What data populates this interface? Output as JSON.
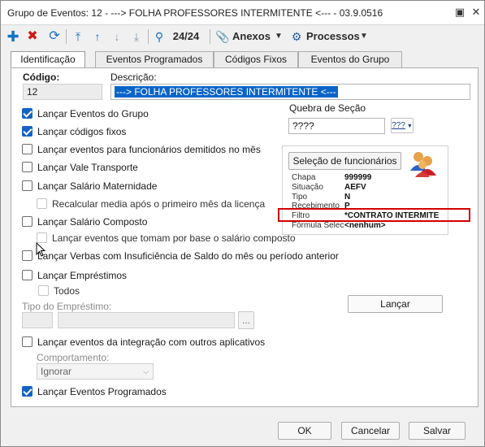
{
  "window": {
    "title": "Grupo de Eventos: 12 - ---> FOLHA PROFESSORES INTERMITENTE <--- - 03.9.0516"
  },
  "toolbar": {
    "record_position": "24/24",
    "anexos_label": "Anexos",
    "processos_label": "Processos"
  },
  "tabs": [
    "Identificação",
    "Eventos Programados",
    "Códigos Fixos",
    "Eventos do Grupo"
  ],
  "form": {
    "codigo_label": "Código:",
    "codigo_value": "12",
    "descricao_label": "Descrição:",
    "descricao_value": "---> FOLHA PROFESSORES INTERMITENTE <---",
    "quebra_label": "Quebra de Seção",
    "quebra_value": "????",
    "quebra_button": "???"
  },
  "options": {
    "eventos_grupo": "Lançar Eventos do Grupo",
    "codigos_fixos": "Lançar códigos fixos",
    "demitidos": "Lançar eventos para funcionários demitidos no mês",
    "vale_transporte": "Lançar Vale Transporte",
    "salario_maternidade": "Lançar Salário Maternidade",
    "recalcular_media": "Recalcular media após o primeiro mês da licença",
    "salario_composto": "Lançar Salário Composto",
    "base_salario_composto": "Lançar eventos que tomam por base o salário composto",
    "verbas_insuficiencia": "Lançar Verbas com Insuficiência de Saldo do mês ou período anterior",
    "emprestimos": "Lançar Empréstimos",
    "todos": "Todos",
    "tipo_emprestimo_label": "Tipo do Empréstimo:",
    "integracao": "Lançar eventos da integração com outros aplicativos",
    "comportamento_label": "Comportamento:",
    "comportamento_value": "Ignorar",
    "eventos_programados": "Lançar Eventos Programados",
    "lancar_button": "Lançar",
    "browse_button": "..."
  },
  "selecao": {
    "button": "Seleção de funcionários",
    "rows": [
      {
        "label": "Chapa",
        "value": "999999"
      },
      {
        "label": "Situação",
        "value": "AEFV"
      },
      {
        "label": "Tipo",
        "value": "N"
      },
      {
        "label": "Recebimento",
        "value": "P"
      },
      {
        "label": "Filtro",
        "value": "*CONTRATO INTERMITE"
      },
      {
        "label": "Fórmula Selec",
        "value": "<nenhum>"
      }
    ]
  },
  "footer": {
    "ok": "OK",
    "cancelar": "Cancelar",
    "salvar": "Salvar"
  }
}
